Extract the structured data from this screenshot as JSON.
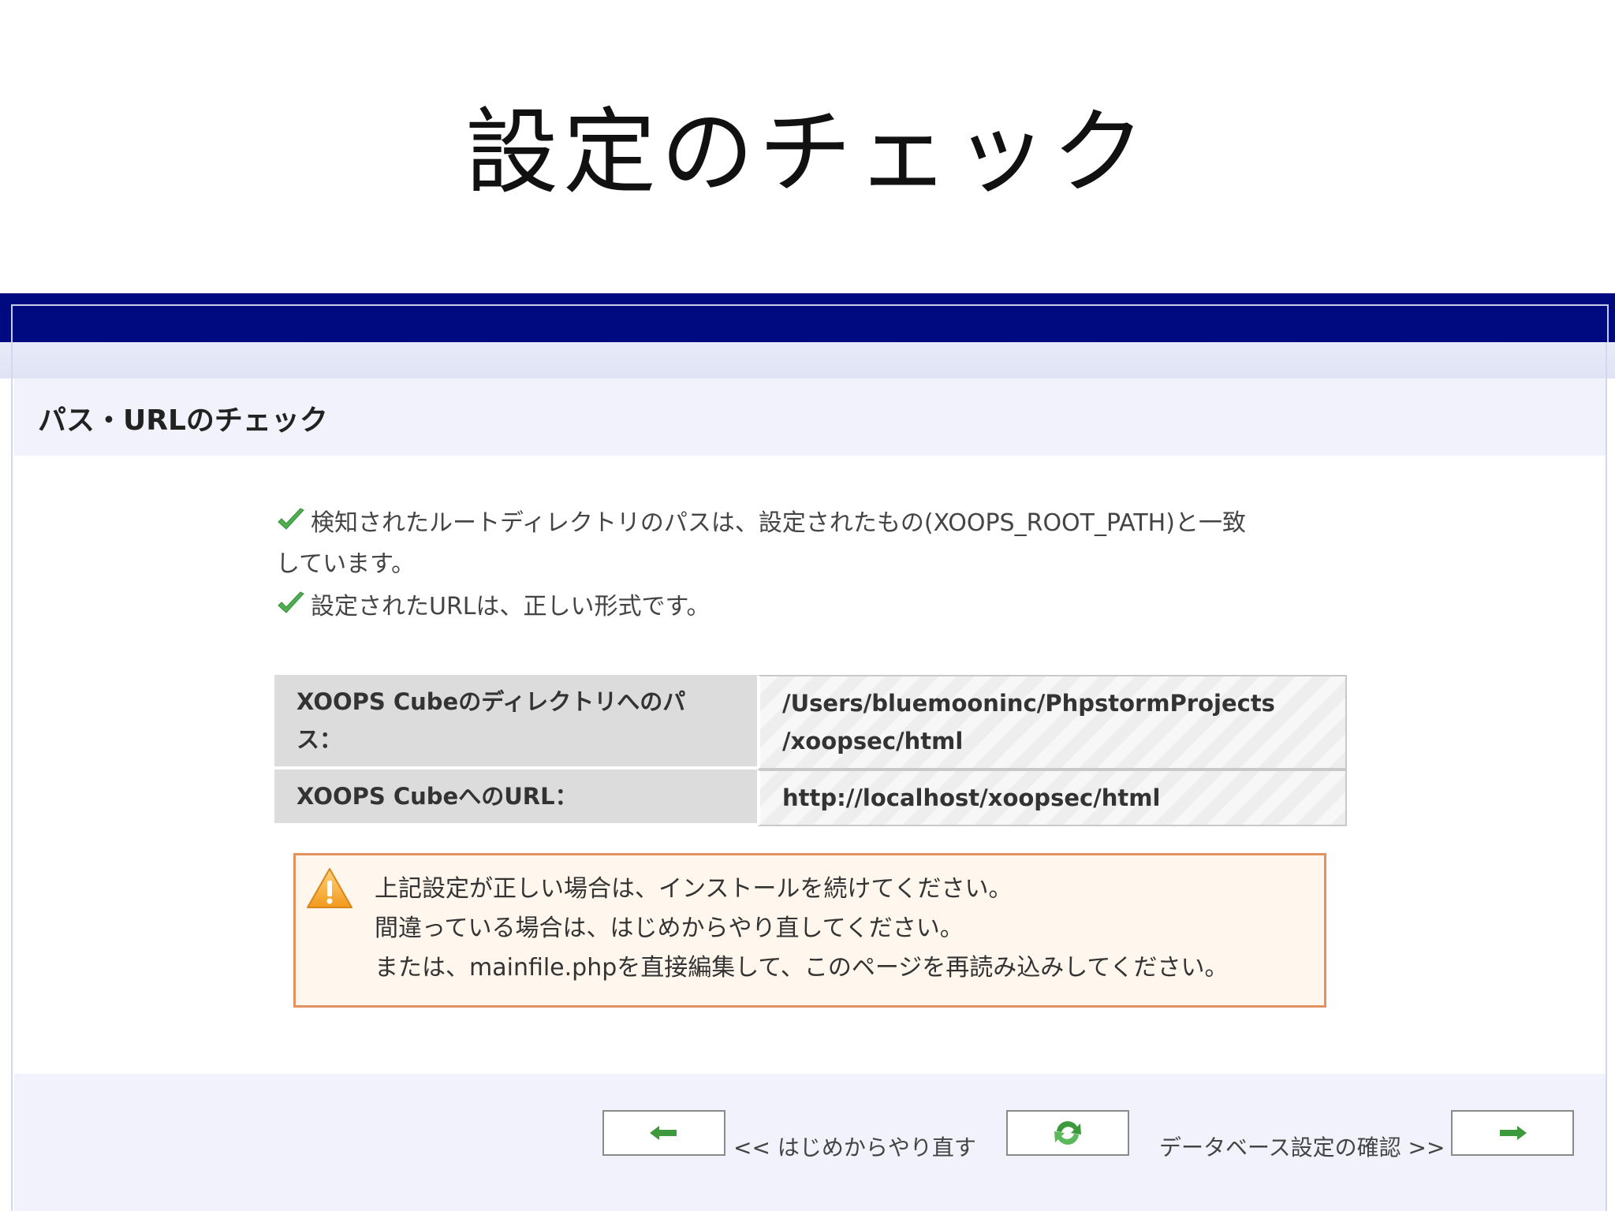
{
  "slide_title": "設定のチェック",
  "section_heading": "パス・URLのチェック",
  "checks": [
    {
      "icon": "checkmark-icon",
      "text": "検知されたルートディレクトリのパスは、設定されたもの(XOOPS_ROOT_PATH)と一致",
      "text2": "しています。"
    },
    {
      "icon": "checkmark-icon",
      "text": "設定されたURLは、正しい形式です。"
    }
  ],
  "info_table": [
    {
      "label_line1": "XOOPS Cubeのディレクトリへのパ",
      "label_line2": "ス：",
      "value_line1": "/Users/bluemooninc/PhpstormProjects",
      "value_line2": "/xoopsec/html"
    },
    {
      "label_line1": "XOOPS CubeへのURL：",
      "value_line1": "http://localhost/xoopsec/html"
    }
  ],
  "warning": {
    "icon": "warning-triangle-icon",
    "lines": [
      "上記設定が正しい場合は、インストールを続けてください。",
      "間違っている場合は、はじめからやり直してください。",
      "または、mainfile.phpを直接編集して、このページを再読み込みしてください。"
    ]
  },
  "footer": {
    "back_label": "<< はじめからやり直す",
    "next_label": "データベース設定の確認 >>",
    "back_icon": "left-arrow-icon",
    "reload_icon": "reload-icon",
    "next_icon": "right-arrow-icon"
  },
  "colors": {
    "topbar": "#000a80",
    "check_green": "#4caf50",
    "warning_border": "#e2915f",
    "warning_bg": "#fff7ed",
    "arrow_green": "#3c9a3c"
  }
}
